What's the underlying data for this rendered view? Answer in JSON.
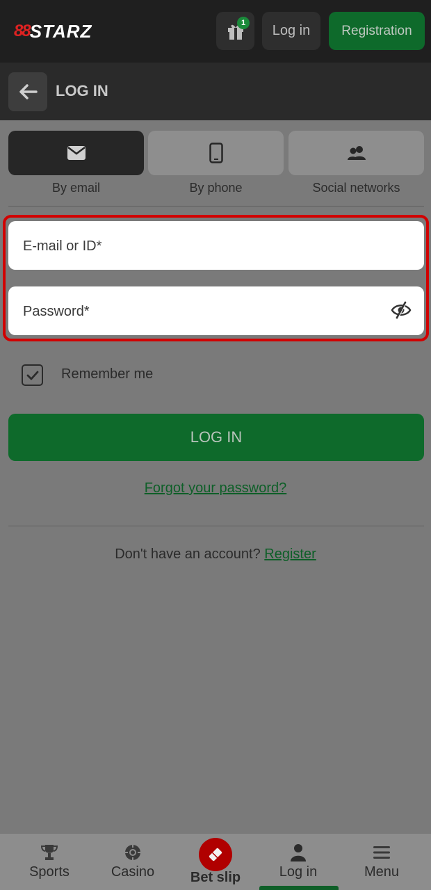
{
  "header": {
    "logo_mark": "88",
    "logo_text": "STARZ",
    "gift_badge": "1",
    "login_label": "Log in",
    "register_label": "Registration"
  },
  "subheader": {
    "title": "LOG IN"
  },
  "tabs": [
    {
      "label": "By email",
      "icon": "envelope-icon",
      "active": true
    },
    {
      "label": "By phone",
      "icon": "phone-icon",
      "active": false
    },
    {
      "label": "Social networks",
      "icon": "users-icon",
      "active": false
    }
  ],
  "form": {
    "email_placeholder": "E-mail or ID*",
    "password_placeholder": "Password*",
    "remember_label": "Remember me",
    "remember_checked": true,
    "submit_label": "LOG IN",
    "forgot_label": "Forgot your password?",
    "no_account_text": "Don't have an account?",
    "register_link": "Register"
  },
  "bottom_nav": {
    "items": [
      {
        "label": "Sports",
        "icon": "trophy-icon"
      },
      {
        "label": "Casino",
        "icon": "casino-chip-icon"
      },
      {
        "label": "Bet slip",
        "icon": "ticket-icon"
      },
      {
        "label": "Log in",
        "icon": "user-icon"
      },
      {
        "label": "Menu",
        "icon": "hamburger-icon"
      }
    ],
    "active": "Log in"
  },
  "colors": {
    "accent_green": "#0e6a2b",
    "highlight_red": "#d10000",
    "betslip_red": "#b00000"
  }
}
